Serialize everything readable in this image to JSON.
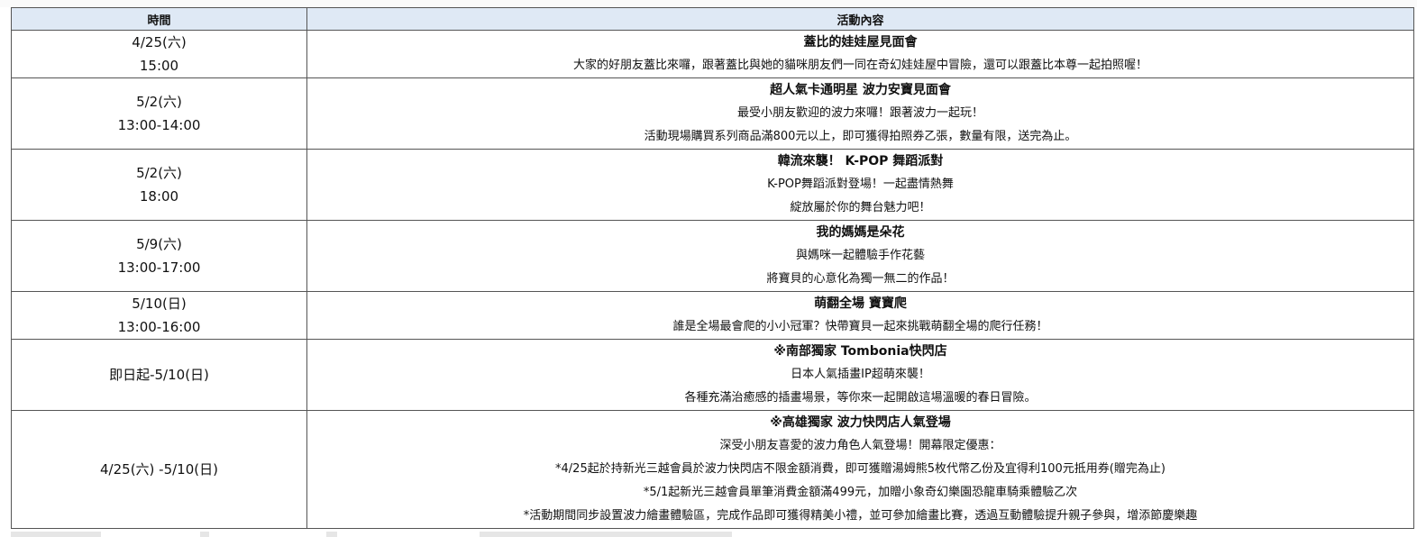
{
  "table": {
    "headers": {
      "time": "時間",
      "activity": "活動內容"
    },
    "rows": [
      {
        "time": [
          "4/25(六)",
          "15:00"
        ],
        "title": "蓋比的娃娃屋見面會",
        "lines": [
          "大家的好朋友蓋比來囉，跟著蓋比與她的貓咪朋友們一同在奇幻娃娃屋中冒險，還可以跟蓋比本尊一起拍照喔！"
        ]
      },
      {
        "time": [
          "5/2(六)",
          "13:00-14:00"
        ],
        "title": "超人氣卡通明星 波力安寶見面會",
        "lines": [
          "最受小朋友歡迎的波力來囉！跟著波力一起玩！",
          "活動現場購買系列商品滿800元以上，即可獲得拍照券乙張，數量有限，送完為止。"
        ]
      },
      {
        "time": [
          "5/2(六)",
          "18:00"
        ],
        "title": "韓流來襲！ K-POP 舞蹈派對",
        "lines": [
          "K-POP舞蹈派對登場！一起盡情熱舞",
          "綻放屬於你的舞台魅力吧！"
        ]
      },
      {
        "time": [
          "5/9(六)",
          "13:00-17:00"
        ],
        "title": "我的媽媽是朵花",
        "lines": [
          "與媽咪一起體驗手作花藝",
          "將寶貝的心意化為獨一無二的作品！"
        ]
      },
      {
        "time": [
          "5/10(日)",
          "13:00-16:00"
        ],
        "title": "萌翻全場 寶寶爬",
        "lines": [
          "誰是全場最會爬的小小冠軍？快帶寶貝一起來挑戰萌翻全場的爬行任務！"
        ]
      },
      {
        "time": [
          "即日起-5/10(日)"
        ],
        "title": "※南部獨家 Tombonia快閃店",
        "lines": [
          "日本人氣插畫IP超萌來襲！",
          "各種充滿治癒感的插畫場景，等你來一起開啟這場溫暖的春日冒險。"
        ]
      },
      {
        "time": [
          "4/25(六) -5/10(日)"
        ],
        "title": "※高雄獨家 波力快閃店人氣登場",
        "lines": [
          "深受小朋友喜愛的波力角色人氣登場！開幕限定優惠：",
          "*4/25起於持新光三越會員於波力快閃店不限金額消費，即可獲贈湯姆熊5枚代幣乙份及宜得利100元抵用券(贈完為止)",
          "*5/1起新光三越會員單筆消費金額滿499元，加贈小象奇幻樂園恐龍車騎乘體驗乙次",
          "*活動期間同步設置波力繪畫體驗區，完成作品即可獲得精美小禮，並可參加繪畫比賽，透過互動體驗提升親子參與，增添節慶樂趣"
        ]
      }
    ]
  }
}
